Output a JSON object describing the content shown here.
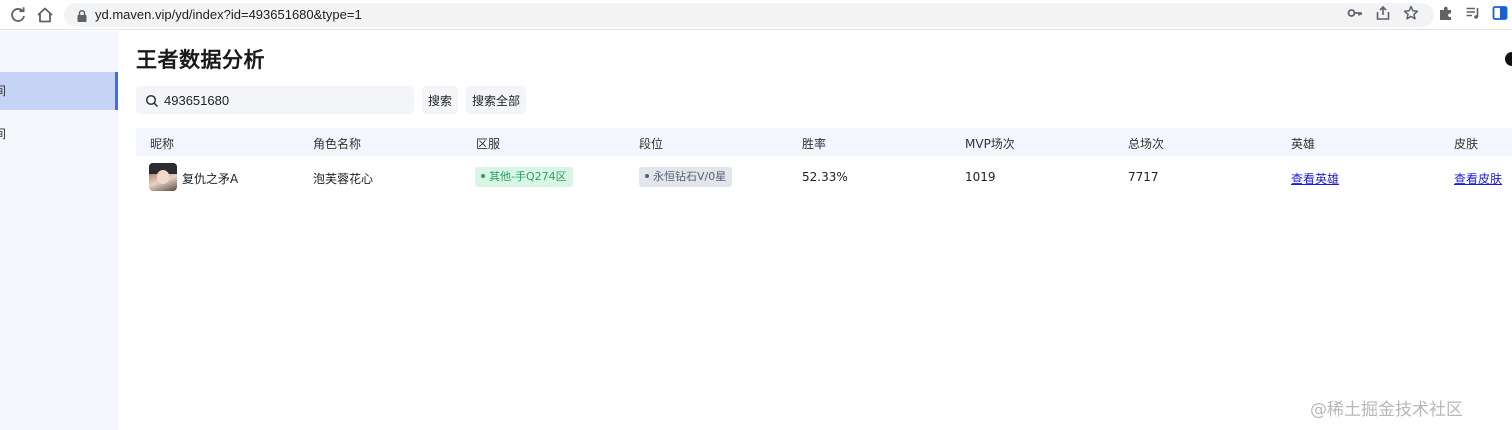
{
  "browser": {
    "url": "yd.maven.vip/yd/index?id=493651680&type=1"
  },
  "sidebar": {
    "items": [
      {
        "label": "间",
        "active": true
      },
      {
        "label": "间",
        "active": false
      }
    ]
  },
  "page": {
    "title": "王者数据分析"
  },
  "search": {
    "value": "493651680",
    "search_label": "搜索",
    "search_all_label": "搜索全部"
  },
  "table": {
    "columns": [
      "昵称",
      "角色名称",
      "区服",
      "段位",
      "胜率",
      "MVP场次",
      "总场次",
      "英雄",
      "皮肤"
    ],
    "rows": [
      {
        "nickname": "复仇之矛A",
        "role_name": "泡芙蓉花心",
        "server": "其他-手Q274区",
        "rank": "永恒钻石V/0星",
        "win_rate": "52.33%",
        "mvp": "1019",
        "total": "7717",
        "hero_link": "查看英雄",
        "skin_link": "查看皮肤"
      }
    ]
  },
  "watermark": "@稀土掘金技术社区",
  "colors": {
    "accent": "#3b6fe8",
    "sidebar_active": "#c6d3f6",
    "tag_green_bg": "#d9f5e6",
    "tag_green_text": "#2e9e62",
    "tag_gray_bg": "#e2e5ec",
    "link": "#1a1adc"
  }
}
